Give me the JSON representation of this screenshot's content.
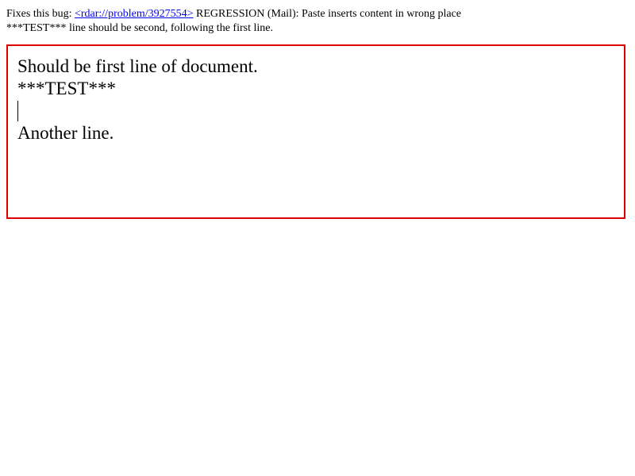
{
  "description": {
    "prefix": "Fixes this bug: ",
    "link_text": "<rdar://problem/3927554>",
    "suffix": " REGRESSION (Mail): Paste inserts content in wrong place",
    "line2": "***TEST*** line should be second, following the first line."
  },
  "editor": {
    "lines": [
      "Should be first line of document.",
      "***TEST***",
      "",
      "Another line."
    ],
    "border_color": "#dd0000"
  },
  "colors": {
    "link": "#0000ee",
    "text": "#000000",
    "background": "#ffffff"
  }
}
